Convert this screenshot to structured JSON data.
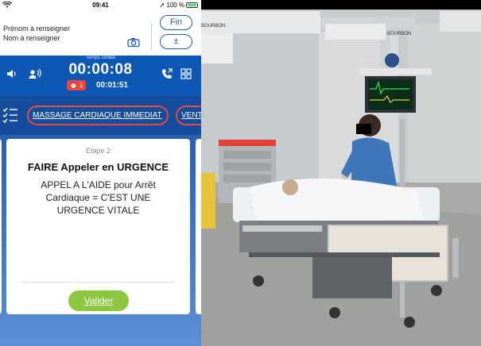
{
  "status_bar": {
    "time": "09:41",
    "battery": "100 %",
    "battery_level": 1.0
  },
  "patient": {
    "first_name": "Prénom à renseigner",
    "last_name": "Nom à renseigner",
    "fin_label": "Fin",
    "plus_label": "±"
  },
  "timer": {
    "label": "Temps Global",
    "global": "00:00:08",
    "alarm_count": "1",
    "step": "00:01:51"
  },
  "actions": {
    "primary": "MASSAGE CARDIAQUE IMMEDIAT",
    "secondary": "VENT"
  },
  "card": {
    "step": "Etape 2",
    "title": "FAIRE Appeler en URGENCE",
    "text": "APPEL A L'AIDE pour Arrêt Cardiaque = C'EST UNE URGENCE VITALE",
    "validate": "Valider"
  },
  "video": {
    "brand": "BOURBON"
  },
  "colors": {
    "blue": "#0d57b5",
    "accent_red": "#e24b3f",
    "green": "#8cc63f"
  },
  "icons": [
    "wifi-icon",
    "camera-icon",
    "speaker-icon",
    "voice-icon",
    "alarm-clock-icon",
    "phone-call-icon",
    "grid-icon",
    "checklist-icon"
  ]
}
